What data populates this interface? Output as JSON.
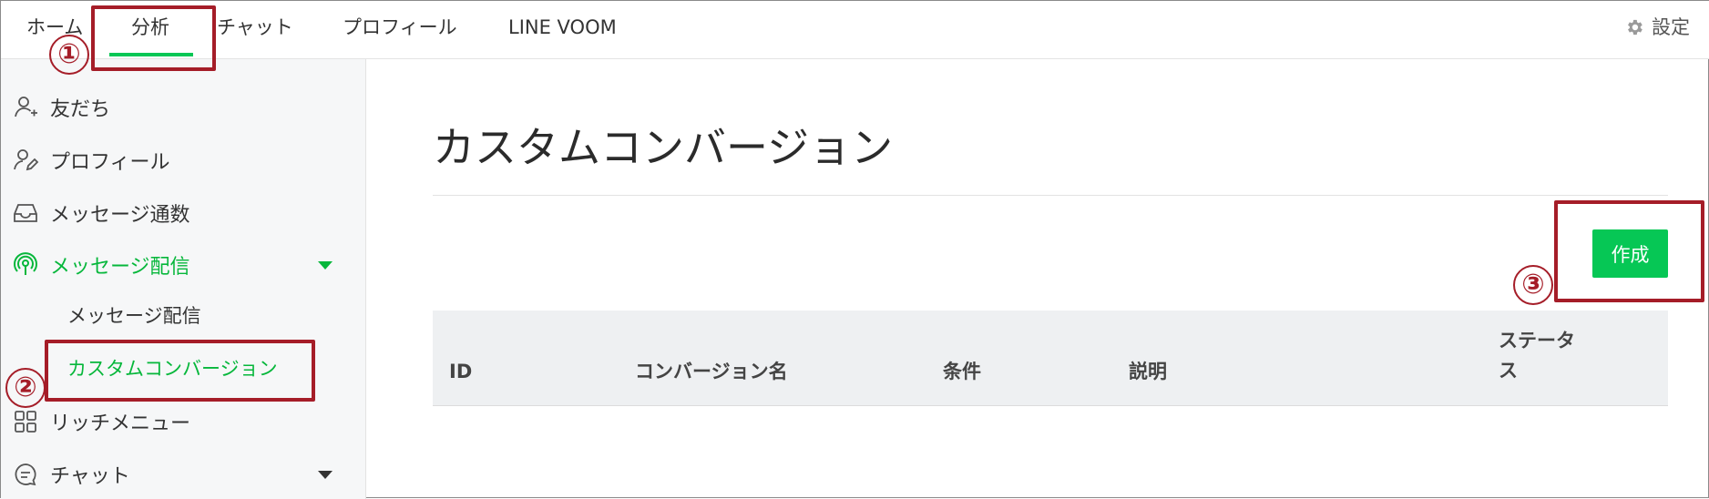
{
  "topnav": {
    "tabs": [
      {
        "label": "ホーム"
      },
      {
        "label": "分析"
      },
      {
        "label": "チャット"
      },
      {
        "label": "プロフィール"
      },
      {
        "label": "LINE VOOM"
      }
    ],
    "active_tab": "分析",
    "settings_label": "設定",
    "settings_icon": "gear-icon"
  },
  "sidebar": {
    "items": [
      {
        "label": "友だち",
        "icon": "add-friend-icon"
      },
      {
        "label": "プロフィール",
        "icon": "profile-edit-icon"
      },
      {
        "label": "メッセージ通数",
        "icon": "inbox-icon"
      },
      {
        "label": "メッセージ配信",
        "icon": "broadcast-icon",
        "expanded": true,
        "active": true
      },
      {
        "label": "リッチメニュー",
        "icon": "grid-icon"
      },
      {
        "label": "チャット",
        "icon": "chat-icon",
        "expanded": false
      }
    ],
    "subitems": [
      {
        "label": "メッセージ配信"
      },
      {
        "label": "カスタムコンバージョン",
        "active": true
      }
    ]
  },
  "main": {
    "title": "カスタムコンバージョン",
    "create_button_label": "作成",
    "table": {
      "columns": [
        "ID",
        "コンバージョン名",
        "条件",
        "説明",
        "ステータス"
      ],
      "status_line1": "ステータ",
      "status_line2": "ス"
    }
  },
  "annotations": {
    "markers": [
      "①",
      "②",
      "③"
    ],
    "color": "#a51d28"
  },
  "colors": {
    "accent": "#06c755",
    "annotation": "#a51d28"
  }
}
